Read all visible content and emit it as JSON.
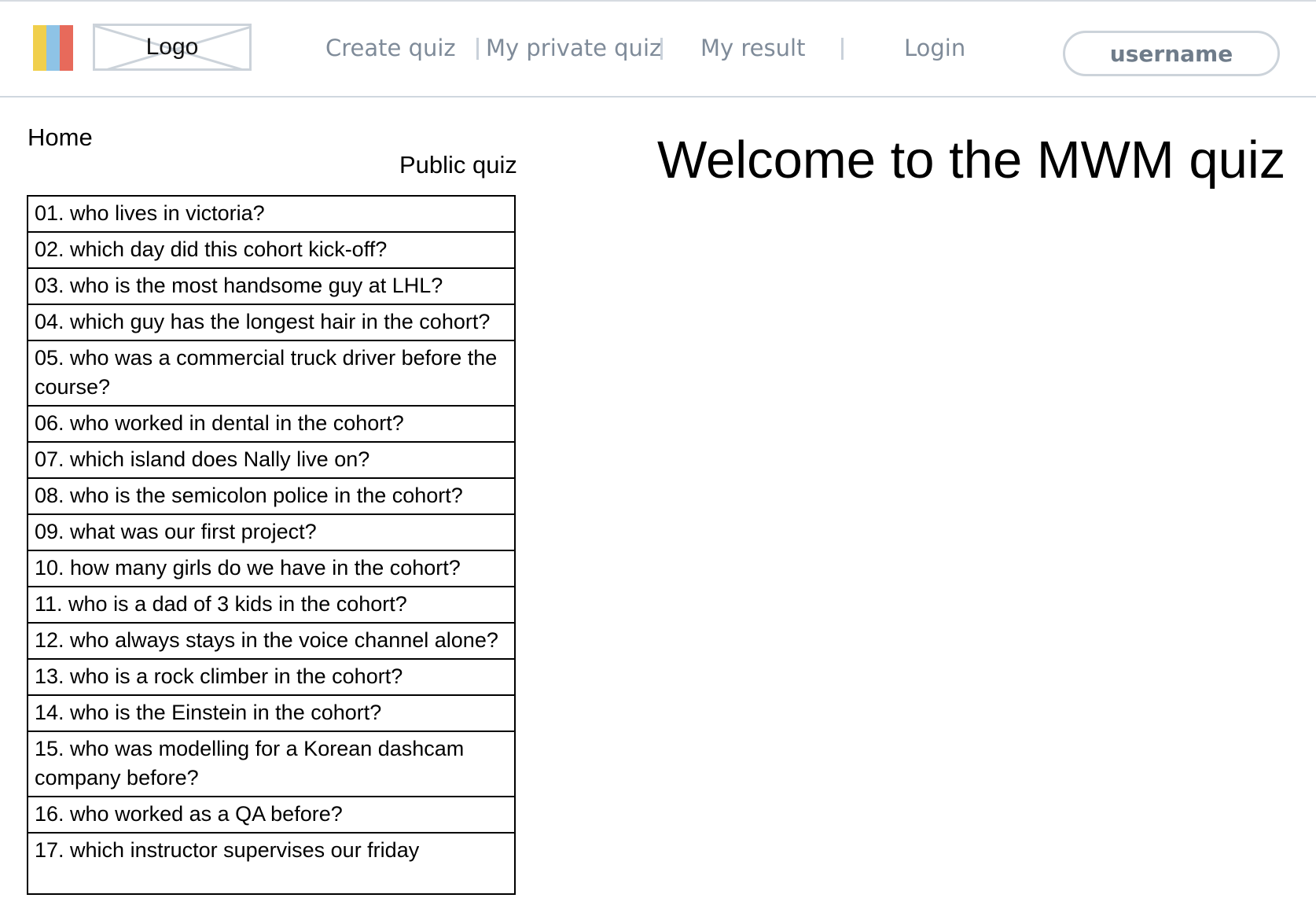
{
  "header": {
    "brand_colors": [
      "#f0cf4c",
      "#8ec3e6",
      "#e76a5b"
    ],
    "logo_label": "Logo",
    "nav": [
      {
        "label": "Create quiz"
      },
      {
        "label": "My private quiz"
      },
      {
        "label": "My result"
      },
      {
        "label": "Login"
      }
    ],
    "username": "username"
  },
  "breadcrumb": {
    "home": "Home"
  },
  "public_quiz": {
    "title": "Public quiz",
    "items": [
      "01. who lives in victoria?",
      "02. which day did this cohort kick-off?",
      "03. who is the most handsome guy at LHL?",
      "04. which guy has the longest hair in the cohort?",
      "05. who was a commercial truck driver before the course?",
      "06. who worked in dental in the cohort?",
      "07. which island does Nally live on?",
      "08. who is the semicolon police in the cohort?",
      "09. what was our first project?",
      "10. how many girls do we have in the cohort?",
      "11. who is a dad of 3 kids in the cohort?",
      "12. who always stays in the voice channel alone?",
      "13. who is a rock climber in the cohort?",
      "14. who is the Einstein in the cohort?",
      "15. who was modelling for a Korean dashcam company before?",
      "16. who worked as a QA before?",
      "17. which instructor supervises our friday"
    ]
  },
  "main": {
    "welcome_title": "Welcome to the MWM quiz"
  }
}
